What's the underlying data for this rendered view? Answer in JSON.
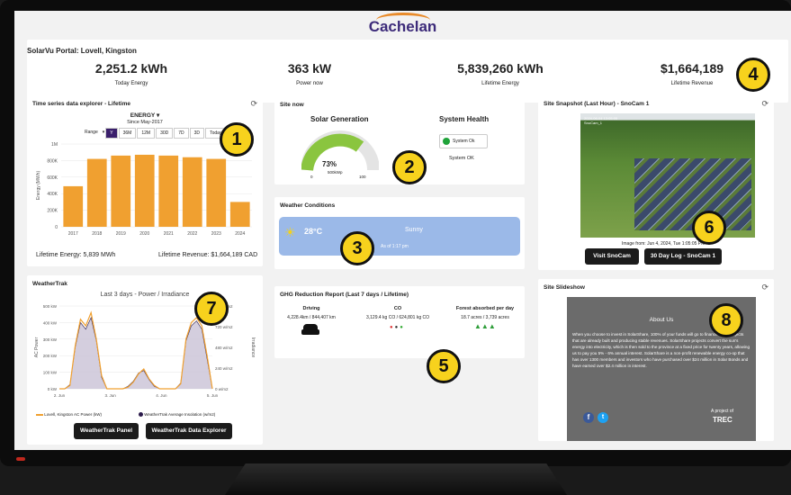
{
  "brand": {
    "name": "Cachelan"
  },
  "portal": {
    "title": "SolarVu Portal: Lovell, Kingston"
  },
  "stats": [
    {
      "value": "2,251.2 kWh",
      "label": "Today Energy"
    },
    {
      "value": "363 kW",
      "label": "Power now"
    },
    {
      "value": "5,839,260 kWh",
      "label": "Lifetime Energy"
    },
    {
      "value": "$1,664,189",
      "label": "Lifetime Revenue"
    }
  ],
  "timeseries": {
    "title": "Time series data explorer - Lifetime",
    "metric": "ENERGY",
    "since": "Since May-2017",
    "range_label": "Range",
    "range_buttons": [
      "Y",
      "36M",
      "12M",
      "30D",
      "7D",
      "3D",
      "Today"
    ],
    "lifetime_energy": "Lifetime Energy: 5,839 MWh",
    "lifetime_revenue": "Lifetime Revenue: $1,664,189 CAD"
  },
  "site_now": {
    "title": "Site now",
    "solar_heading": "Solar Generation",
    "gauge_percent": "73%",
    "gauge_unit": "500kWp",
    "gauge_min": "0",
    "gauge_max": "100",
    "health_heading": "System Health",
    "health_status": "System Ok",
    "health_text": "System OK"
  },
  "weather": {
    "title": "Weather Conditions",
    "temp": "28°C",
    "condition": "Sunny",
    "asof": "As of 1:17 pm"
  },
  "ghg": {
    "title": "GHG Reduction Report (Last 7 days / Lifetime)",
    "driving_label": "Driving",
    "driving_value": "4,228.4km / 844,407 km",
    "co_label": "CO",
    "co_value": "3,129.4 kg CO / 624,801 kg CO",
    "forest_label": "Forest absorbed per day",
    "forest_value": "18.7 acres / 3,739 acres"
  },
  "snapshot": {
    "title": "Site Snapshot (Last Hour) - SnoCam 1",
    "stamp": "2024-06-04 13:05:05\nSnoCam_1",
    "image_caption": "Image from: Jun 4, 2024, Tue 1:05:05 PM",
    "visit_btn": "Visit SnoCam",
    "log_btn": "30 Day Log - SnoCam 1"
  },
  "weathertrak": {
    "title": "WeatherTrak",
    "chart_title": "Last 3 days - Power / Irradiance",
    "ylabel_left": "AC Power",
    "ylabel_right": "Irradiance",
    "legend_power": "Lovell, Kingston AC Power (kW)",
    "legend_insol": "WeatherTrak Average Insolation (w/m2)",
    "panel_btn": "WeatherTrak Panel",
    "explorer_btn": "WeatherTrak Data Explorer"
  },
  "slideshow": {
    "title": "Site Slideshow",
    "heading": "About Us",
    "body": "When you choose to invest in SolarShare, 100% of your funds will go to finance solar projects that are already built and producing stable revenues. SolarShare projects convert the sun's energy into electricity, which is then sold to the province at a fixed price for twenty years, allowing us to pay you 5% - 6% annual interest. SolarShare is a non-profit renewable energy co-op that has over 1300 members and investors who have purchased over $24 million in Solar Bonds and have earned over $2.4 million in interest.",
    "project_of": "A project of",
    "org": "TREC"
  },
  "badges": [
    "1",
    "2",
    "3",
    "4",
    "5",
    "6",
    "7",
    "8"
  ],
  "chart_data": [
    {
      "type": "bar",
      "title": "ENERGY",
      "categories": [
        "2017",
        "2018",
        "2019",
        "2020",
        "2021",
        "2022",
        "2023",
        "2024"
      ],
      "values": [
        490,
        820,
        860,
        870,
        860,
        840,
        820,
        300
      ],
      "ylabel": "Energy (MWh)",
      "yticks": [
        "0",
        "200K",
        "400K",
        "600K",
        "800K",
        "1M"
      ],
      "ylim": [
        0,
        1000
      ],
      "color": "#f0a030"
    },
    {
      "type": "line",
      "title": "Last 3 days - Power / Irradiance",
      "xticks": [
        "2. Jun",
        "3. Jun",
        "4. Jun",
        "5. Jun"
      ],
      "yticks_left": [
        "0 kW",
        "100 kW",
        "200 kW",
        "300 kW",
        "400 kW",
        "500 kW"
      ],
      "yticks_right": [
        "0 w/m2",
        "240 w/m2",
        "480 w/m2",
        "720 w/m2",
        "960 w/m2"
      ],
      "series": [
        {
          "name": "Lovell, Kingston AC Power (kW)",
          "color": "#f0a030",
          "values": [
            0,
            0,
            20,
            260,
            420,
            380,
            460,
            300,
            80,
            0,
            0,
            0,
            0,
            10,
            40,
            90,
            120,
            60,
            20,
            0,
            0,
            0,
            0,
            30,
            300,
            400,
            430,
            380,
            200,
            0
          ]
        },
        {
          "name": "WeatherTrak Average Insolation (w/m2)",
          "color": "#2a1a4a",
          "values": [
            0,
            0,
            25,
            250,
            400,
            360,
            430,
            290,
            70,
            0,
            0,
            0,
            0,
            15,
            45,
            95,
            110,
            55,
            15,
            0,
            0,
            0,
            0,
            35,
            290,
            380,
            410,
            360,
            180,
            0
          ]
        }
      ]
    }
  ]
}
